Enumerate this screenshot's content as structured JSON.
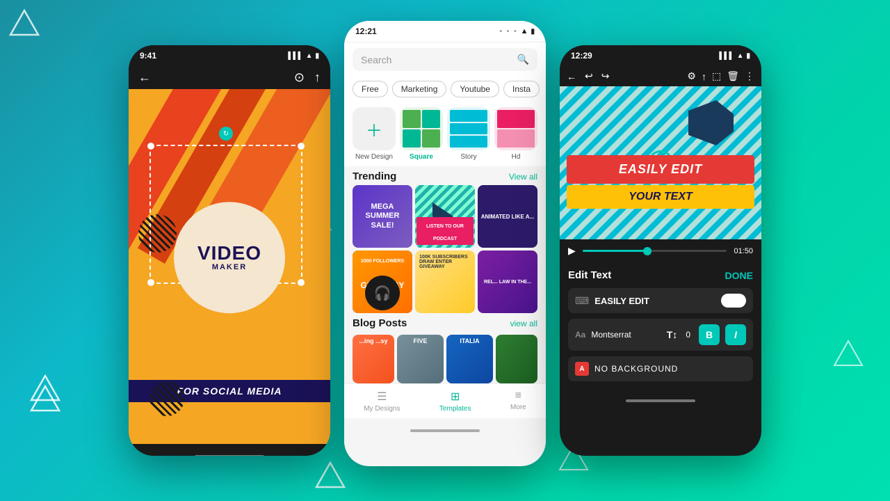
{
  "background": {
    "gradient_start": "#1a8fa0",
    "gradient_end": "#00e0b0"
  },
  "decorations": {
    "triangles": [
      "top-left",
      "mid-left",
      "mid-right",
      "bottom-left",
      "bottom-right",
      "right-mid",
      "right-bottom"
    ]
  },
  "phone_left": {
    "status_time": "9:41",
    "back_icon": "←",
    "save_icon": "⊙",
    "share_icon": "↑",
    "canvas": {
      "title": "VIDEO",
      "subtitle": "MAKER",
      "bottom_banner": "FOR SOCIAL MEDIA"
    }
  },
  "phone_mid": {
    "status_time": "12:21",
    "three_dots": "• • •",
    "search": {
      "placeholder": "Search",
      "icon": "🔍"
    },
    "filters": [
      "Free",
      "Marketing",
      "Youtube",
      "Insta"
    ],
    "templates": [
      {
        "label": "New Design",
        "type": "new"
      },
      {
        "label": "Square",
        "type": "square",
        "active": true
      },
      {
        "label": "Story",
        "type": "story"
      },
      {
        "label": "Hd",
        "type": "hd"
      }
    ],
    "trending": {
      "title": "Trending",
      "view_all": "View all",
      "items": [
        {
          "text": "MEGA SUMMER SALE!"
        },
        {
          "text": "LISTEN TO OUR PODCAST"
        },
        {
          "text": "ANIMATED LIKE A..."
        }
      ]
    },
    "trending_row2": [
      {
        "text": "1000 FOLLOWERS GIVEAWAY"
      },
      {
        "text": "100K SUBSCRIBERS DRAW ENTER GIVEAWAY"
      },
      {
        "text": "REL... LAW IN THE..."
      }
    ],
    "blog_posts": {
      "title": "Blog Posts",
      "view_all": "view all"
    },
    "nav": [
      {
        "label": "My Designs",
        "icon": "☰",
        "active": false
      },
      {
        "label": "Templates",
        "icon": "⊞",
        "active": true
      },
      {
        "label": "More",
        "icon": "≡",
        "active": false
      }
    ]
  },
  "phone_right": {
    "status_time": "12:29",
    "toolbar_icons": [
      "←",
      "↩",
      "↪",
      "⚙",
      "↑",
      "⬚",
      "🗑",
      "⋮"
    ],
    "canvas": {
      "main_text": "EASILY EDIT",
      "sub_text": "YOUR TEXT"
    },
    "playback": {
      "time": "01:50",
      "progress_percent": 45
    },
    "edit_panel": {
      "title": "Edit Text",
      "done_label": "DONE",
      "text_value": "EASILY EDIT",
      "font_name": "Montserrat",
      "font_size": "0",
      "bold": "B",
      "italic": "I",
      "no_background": "NO BACKGROUND"
    }
  }
}
